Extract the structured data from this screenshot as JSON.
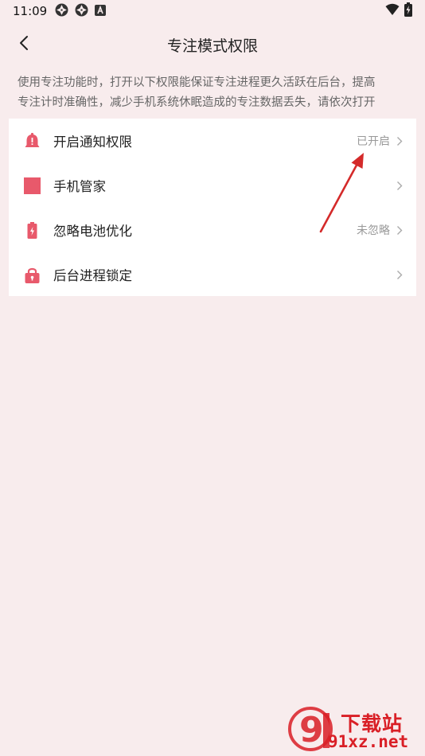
{
  "status_bar": {
    "time": "11:09",
    "left_icons": [
      "aperture-icon",
      "aperture-icon",
      "font-a-icon"
    ],
    "right_icons": [
      "wifi-icon",
      "battery-charging-icon"
    ]
  },
  "header": {
    "title": "专注模式权限",
    "back_icon": "chevron-left-icon"
  },
  "description": {
    "line1": "使用专注功能时，打开以下权限能保证专注进程更久活跃在后台，提高",
    "line2": "专注计时准确性，减少手机系统休眠造成的专注数据丢失，请依次打开"
  },
  "settings": {
    "accent_color": "#e8596b",
    "items": [
      {
        "icon": "bell-icon",
        "label": "开启通知权限",
        "status": "已开启"
      },
      {
        "icon": "square-icon",
        "label": "手机管家",
        "status": ""
      },
      {
        "icon": "battery-icon",
        "label": "忽略电池优化",
        "status": "未忽略"
      },
      {
        "icon": "lock-icon",
        "label": "后台进程锁定",
        "status": ""
      }
    ]
  },
  "watermark": {
    "logo_text": "9",
    "site_name": "下载站",
    "url": "91xz.net",
    "color": "#d91f26"
  }
}
